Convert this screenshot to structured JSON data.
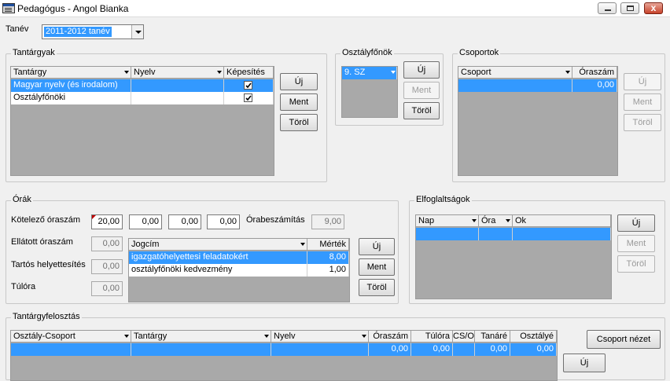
{
  "window": {
    "title": "Pedagógus - Angol Bianka",
    "close_glyph": "x"
  },
  "tanev": {
    "label": "Tanév",
    "value": "2011-2012 tanév"
  },
  "tantargyak": {
    "title": "Tantárgyak",
    "columns": [
      "Tantárgy",
      "Nyelv",
      "Képesítés"
    ],
    "rows": [
      {
        "tantargy": "Magyar nyelv (és irodalom)",
        "nyelv": "",
        "kepesites": true
      },
      {
        "tantargy": "Osztályfőnöki",
        "nyelv": "",
        "kepesites": true
      }
    ],
    "buttons": {
      "new": "Új",
      "save": "Ment",
      "delete": "Töröl"
    }
  },
  "osztalyfonokok": {
    "title": "Osztályfőnök",
    "value": "9. SZ",
    "buttons": {
      "new": "Új",
      "save": "Ment",
      "delete": "Töröl"
    }
  },
  "csoportok": {
    "title": "Csoportok",
    "columns": [
      "Csoport",
      "Óraszám"
    ],
    "row": {
      "csoport": "",
      "oraszam": "0,00"
    },
    "buttons": {
      "new": "Új",
      "save": "Ment",
      "delete": "Töröl"
    }
  },
  "orak": {
    "title": "Órák",
    "kotelezo_label": "Kötelező óraszám",
    "kotelezo_values": [
      "20,00",
      "0,00",
      "0,00",
      "0,00"
    ],
    "orabeszamitas_label": "Órabeszámítás",
    "orabeszamitas_value": "9,00",
    "ellatott_label": "Ellátott óraszám",
    "ellatott_value": "0,00",
    "tartos_label": "Tartós helyettesítés",
    "tartos_value": "0,00",
    "tulora_label": "Túlóra",
    "tulora_value": "0,00",
    "columns": [
      "Jogcím",
      "Mérték"
    ],
    "rows": [
      {
        "jogcim": "igazgatóhelyettesi feladatokért",
        "mertek": "8,00"
      },
      {
        "jogcim": "osztályfőnöki kedvezmény",
        "mertek": "1,00"
      }
    ],
    "buttons": {
      "new": "Új",
      "save": "Ment",
      "delete": "Töröl"
    }
  },
  "elfoglaltsagok": {
    "title": "Elfoglaltságok",
    "columns": [
      "Nap",
      "Óra",
      "Ok"
    ],
    "buttons": {
      "new": "Új",
      "save": "Ment",
      "delete": "Töröl"
    }
  },
  "tantargyfelosztas": {
    "title": "Tantárgyfelosztás",
    "columns": [
      "Osztály-Csoport",
      "Tantárgy",
      "Nyelv",
      "Óraszám",
      "Túlóra",
      "CS/O",
      "Tanáré",
      "Osztályé"
    ],
    "row": {
      "oraszam": "0,00",
      "tulora": "0,00",
      "tanare": "0,00",
      "osztalye": "0,00"
    },
    "buttons": {
      "group_view": "Csoport nézet",
      "new": "Új"
    }
  },
  "colors": {
    "selection": "#3399ff",
    "grid_bg": "#a9a9a9"
  }
}
